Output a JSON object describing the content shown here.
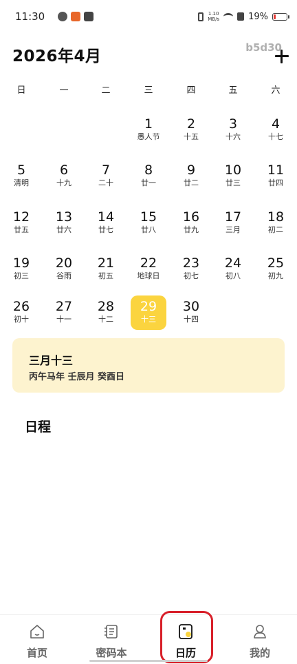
{
  "status_bar": {
    "time": "11:30",
    "net_speed_value": "1.10",
    "net_speed_unit": "MB/s",
    "battery_percent": "19%",
    "battery_level": 0.19,
    "battery_color": "#e53935"
  },
  "header": {
    "title": "2026年4月",
    "tag": "b5d30",
    "add_icon": "plus-icon"
  },
  "calendar": {
    "weekdays": [
      "日",
      "一",
      "二",
      "三",
      "四",
      "五",
      "六"
    ],
    "weeks": [
      [
        null,
        null,
        null,
        {
          "day": "1",
          "lunar": "愚人节"
        },
        {
          "day": "2",
          "lunar": "十五"
        },
        {
          "day": "3",
          "lunar": "十六"
        },
        {
          "day": "4",
          "lunar": "十七"
        }
      ],
      [
        {
          "day": "5",
          "lunar": "清明"
        },
        {
          "day": "6",
          "lunar": "十九"
        },
        {
          "day": "7",
          "lunar": "二十"
        },
        {
          "day": "8",
          "lunar": "廿一"
        },
        {
          "day": "9",
          "lunar": "廿二"
        },
        {
          "day": "10",
          "lunar": "廿三"
        },
        {
          "day": "11",
          "lunar": "廿四"
        }
      ],
      [
        {
          "day": "12",
          "lunar": "廿五"
        },
        {
          "day": "13",
          "lunar": "廿六"
        },
        {
          "day": "14",
          "lunar": "廿七"
        },
        {
          "day": "15",
          "lunar": "廿八"
        },
        {
          "day": "16",
          "lunar": "廿九"
        },
        {
          "day": "17",
          "lunar": "三月"
        },
        {
          "day": "18",
          "lunar": "初二"
        }
      ],
      [
        {
          "day": "19",
          "lunar": "初三"
        },
        {
          "day": "20",
          "lunar": "谷雨"
        },
        {
          "day": "21",
          "lunar": "初五"
        },
        {
          "day": "22",
          "lunar": "地球日"
        },
        {
          "day": "23",
          "lunar": "初七"
        },
        {
          "day": "24",
          "lunar": "初八"
        },
        {
          "day": "25",
          "lunar": "初九"
        }
      ],
      [
        {
          "day": "26",
          "lunar": "初十"
        },
        {
          "day": "27",
          "lunar": "十一"
        },
        {
          "day": "28",
          "lunar": "十二"
        },
        {
          "day": "29",
          "lunar": "十三",
          "selected": true
        },
        {
          "day": "30",
          "lunar": "十四"
        },
        null,
        null
      ]
    ],
    "selected_color": "#fbd43f"
  },
  "selected_info": {
    "lunar_date": "三月十三",
    "ganzhi": "丙午马年 壬辰月 癸酉日"
  },
  "schedule": {
    "title": "日程"
  },
  "bottom_nav": {
    "items": [
      {
        "label": "首页",
        "icon": "home-icon",
        "active": false
      },
      {
        "label": "密码本",
        "icon": "notebook-icon",
        "active": false
      },
      {
        "label": "日历",
        "icon": "calendar-icon",
        "active": true
      },
      {
        "label": "我的",
        "icon": "profile-icon",
        "active": false
      }
    ],
    "highlight_color": "#d8202a"
  }
}
